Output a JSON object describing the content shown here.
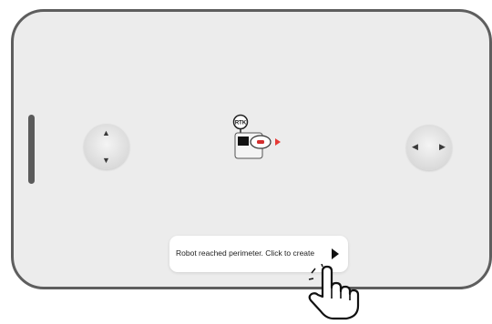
{
  "toast": {
    "message": "Robot reached perimeter. Click to create"
  },
  "robot": {
    "badge": "RTK"
  },
  "icons": {
    "toast_action": "play-triangle-icon",
    "cursor": "hand-pointer-icon",
    "joystick_left": "vertical-joystick",
    "joystick_right": "horizontal-joystick"
  },
  "colors": {
    "frame": "#5e5e5e",
    "screen": "#ececec",
    "direction_arrow": "#e53935"
  }
}
